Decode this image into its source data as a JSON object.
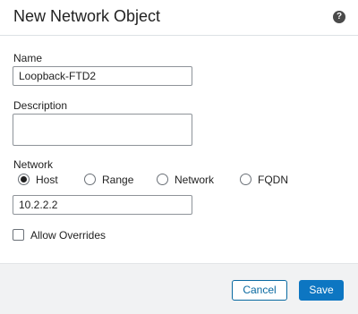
{
  "dialog": {
    "title": "New Network Object",
    "help_icon": "question-circle-icon",
    "help_glyph": "?"
  },
  "form": {
    "name": {
      "label": "Name",
      "value": "Loopback-FTD2"
    },
    "description": {
      "label": "Description",
      "value": ""
    },
    "network": {
      "label": "Network",
      "options": [
        {
          "label": "Host",
          "selected": true
        },
        {
          "label": "Range",
          "selected": false
        },
        {
          "label": "Network",
          "selected": false
        },
        {
          "label": "FQDN",
          "selected": false
        }
      ],
      "value": "10.2.2.2"
    },
    "allow_overrides": {
      "label": "Allow Overrides",
      "checked": false
    }
  },
  "footer": {
    "cancel_label": "Cancel",
    "save_label": "Save"
  },
  "colors": {
    "primary": "#0d76c2",
    "footer_bg": "#f1f2f3"
  }
}
